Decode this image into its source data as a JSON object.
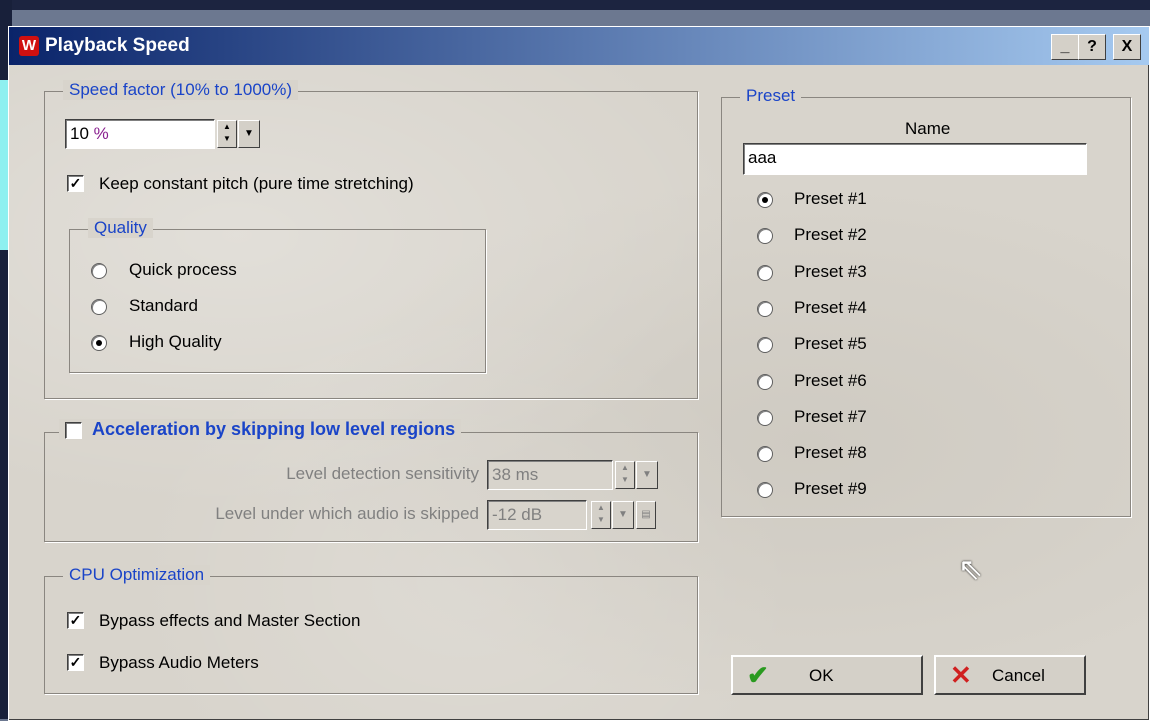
{
  "window": {
    "title": "Playback Speed",
    "logo": "W",
    "buttons": [
      "_",
      "?",
      "X"
    ]
  },
  "speed_factor": {
    "legend": "Speed factor (10% to 1000%)",
    "value": "10",
    "unit": "%",
    "keep_pitch_label": "Keep constant pitch (pure time stretching)",
    "keep_pitch_checked": true
  },
  "quality": {
    "legend": "Quality",
    "options": [
      "Quick process",
      "Standard",
      "High Quality"
    ],
    "selected": "High Quality"
  },
  "acceleration": {
    "legend": "Acceleration by skipping low level regions",
    "checked": false,
    "sensitivity_label": "Level detection sensitivity",
    "sensitivity_value": "38 ms",
    "level_label": "Level under which audio is skipped",
    "level_value": "-12 dB"
  },
  "cpu": {
    "legend": "CPU Optimization",
    "bypass_effects_label": "Bypass effects and Master Section",
    "bypass_effects_checked": true,
    "bypass_meters_label": "Bypass Audio Meters",
    "bypass_meters_checked": true
  },
  "preset": {
    "legend": "Preset",
    "name_label": "Name",
    "name_value": "aaa",
    "items": [
      "Preset #1",
      "Preset #2",
      "Preset #3",
      "Preset #4",
      "Preset #5",
      "Preset #6",
      "Preset #7",
      "Preset #8",
      "Preset #9"
    ],
    "selected_index": 0
  },
  "buttons": {
    "ok": "OK",
    "cancel": "Cancel"
  },
  "colors": {
    "accent": "#1a44c8",
    "title_start": "#0a246a",
    "ok_check": "#2a9a20",
    "cancel_x": "#d02020"
  }
}
